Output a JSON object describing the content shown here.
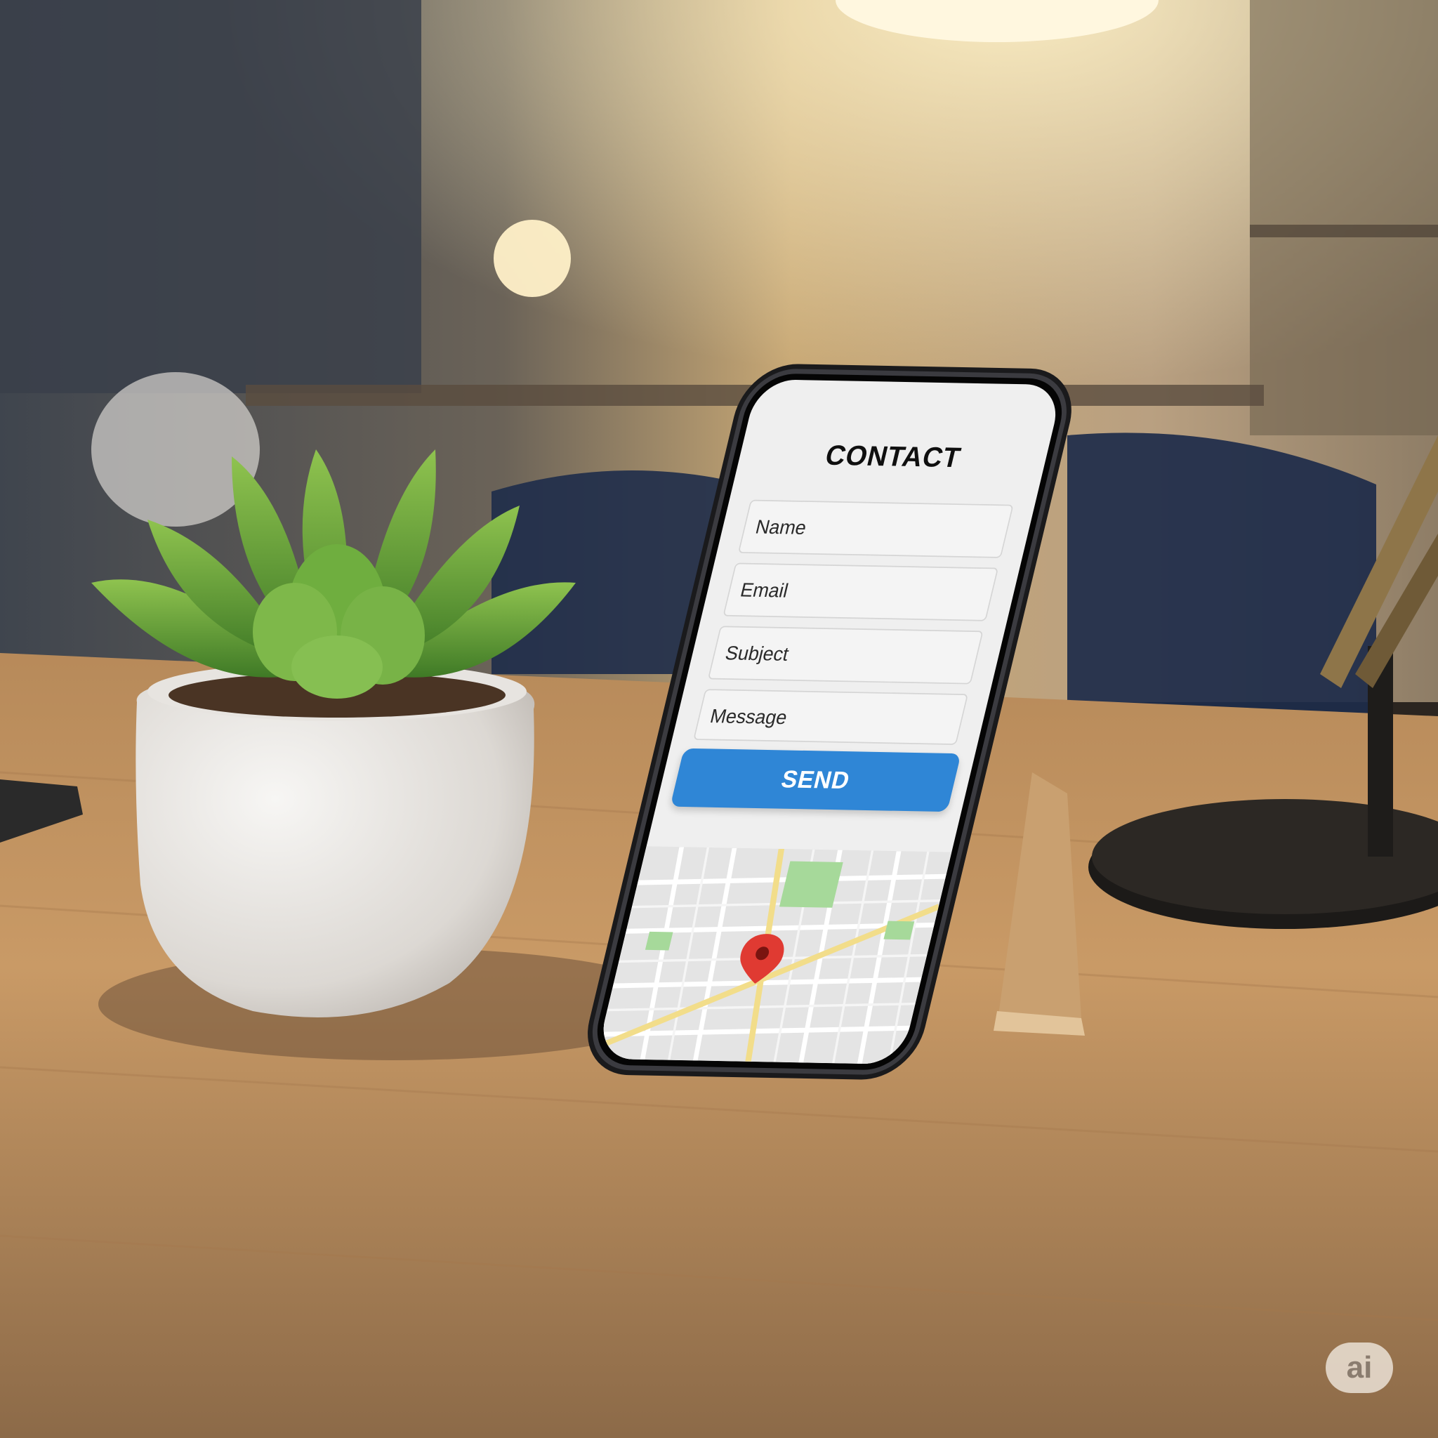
{
  "contact_form": {
    "title": "CONTACT",
    "fields": {
      "name_placeholder": "Name",
      "email_placeholder": "Email",
      "subject_placeholder": "Subject",
      "message_placeholder": "Message"
    },
    "send_label": "SEND"
  },
  "map": {
    "pin_color": "#e03a32",
    "park_color": "#a6d99a",
    "road_color": "#f2dd8a"
  },
  "watermark": {
    "text": "ai"
  },
  "scene_icons": [
    "succulent-plant",
    "desk-lamp",
    "phone-stand"
  ]
}
